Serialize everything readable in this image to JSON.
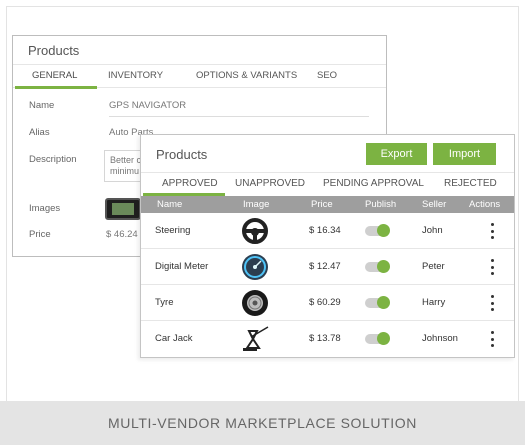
{
  "back_panel": {
    "title": "Products",
    "tabs": [
      "GENERAL",
      "INVENTORY",
      "OPTIONS & VARIANTS",
      "SEO"
    ],
    "active_tab": "GENERAL",
    "fields": {
      "name_label": "Name",
      "name_value": "GPS NAVIGATOR",
      "alias_label": "Alias",
      "alias_value": "Auto Parts",
      "description_label": "Description",
      "description_value": "Better c minimu",
      "images_label": "Images",
      "price_label": "Price",
      "price_value": "$ 46.24"
    }
  },
  "front_panel": {
    "title": "Products",
    "export_label": "Export",
    "import_label": "Import",
    "tabs": [
      "APPROVED",
      "UNAPPROVED",
      "PENDING APPROVAL",
      "REJECTED"
    ],
    "active_tab": "APPROVED",
    "columns": [
      "Name",
      "Image",
      "Price",
      "Publish",
      "Seller",
      "Actions"
    ],
    "rows": [
      {
        "name": "Steering",
        "image": "steering-wheel-icon",
        "price": "$ 16.34",
        "published": true,
        "seller": "John"
      },
      {
        "name": "Digital Meter",
        "image": "speedometer-icon",
        "price": "$ 12.47",
        "published": true,
        "seller": "Peter"
      },
      {
        "name": "Tyre",
        "image": "tyre-icon",
        "price": "$ 60.29",
        "published": true,
        "seller": "Harry"
      },
      {
        "name": "Car Jack",
        "image": "car-jack-icon",
        "price": "$ 13.78",
        "published": true,
        "seller": "Johnson"
      }
    ]
  },
  "footer": {
    "caption": "MULTI-VENDOR MARKETPLACE SOLUTION"
  },
  "colors": {
    "accent": "#7cb342",
    "header_gray": "#9e9e9e",
    "footer_bg": "#e4e4e4"
  }
}
